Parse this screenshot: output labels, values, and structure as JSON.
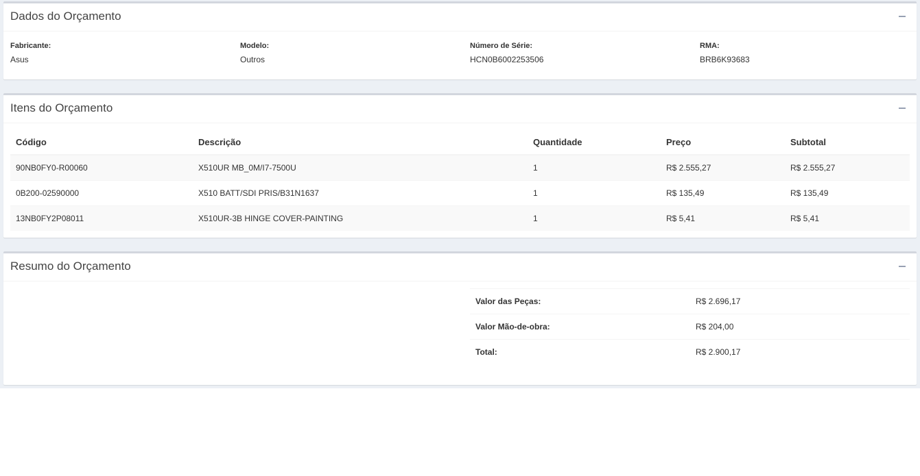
{
  "dados": {
    "title": "Dados do Orçamento",
    "fields": [
      {
        "label": "Fabricante:",
        "value": "Asus"
      },
      {
        "label": "Modelo:",
        "value": "Outros"
      },
      {
        "label": "Número de Série:",
        "value": "HCN0B6002253506"
      },
      {
        "label": "RMA:",
        "value": "BRB6K93683"
      }
    ]
  },
  "itens": {
    "title": "Itens do Orçamento",
    "columns": [
      "Código",
      "Descrição",
      "Quantidade",
      "Preço",
      "Subtotal"
    ],
    "rows": [
      [
        "90NB0FY0-R00060",
        "X510UR MB_0M/I7-7500U",
        "1",
        "R$ 2.555,27",
        "R$ 2.555,27"
      ],
      [
        "0B200-02590000",
        "X510 BATT/SDI PRIS/B31N1637",
        "1",
        "R$ 135,49",
        "R$ 135,49"
      ],
      [
        "13NB0FY2P08011",
        "X510UR-3B HINGE COVER-PAINTING",
        "1",
        "R$ 5,41",
        "R$ 5,41"
      ]
    ]
  },
  "resumo": {
    "title": "Resumo do Orçamento",
    "rows": [
      {
        "label": "Valor das Peças:",
        "value": "R$ 2.696,17"
      },
      {
        "label": "Valor Mão-de-obra:",
        "value": "R$ 204,00"
      },
      {
        "label": "Total:",
        "value": "R$ 2.900,17"
      }
    ]
  },
  "icons": {
    "collapse": "minus-icon"
  },
  "colors": {
    "content_bg": "#ecf0f5",
    "box_border": "#d2d6de",
    "collapse_icon": "#97a0b3"
  }
}
